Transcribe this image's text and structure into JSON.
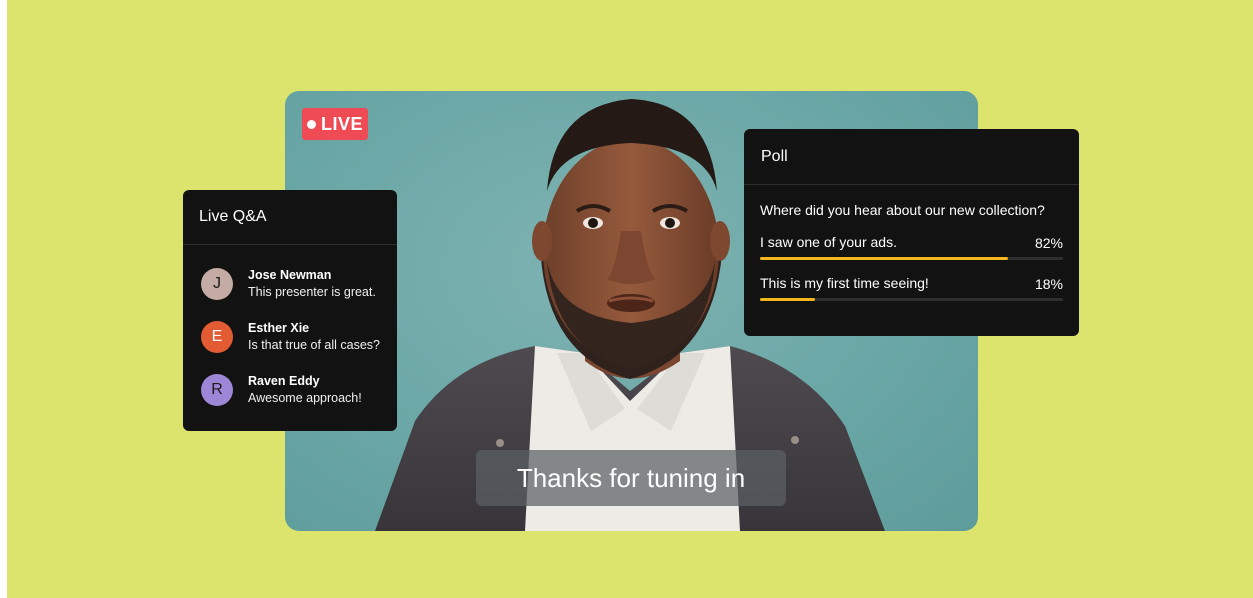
{
  "colors": {
    "background": "#dde46e",
    "live": "#ef4b55",
    "panel": "#121212",
    "poll_bar": "#f3b71b"
  },
  "stream": {
    "live_label": "LIVE",
    "caption": "Thanks for tuning in"
  },
  "qa": {
    "title": "Live Q&A",
    "items": [
      {
        "initial": "J",
        "name": "Jose Newman",
        "message": "This presenter is great.",
        "avatar_color": "#c4aba3"
      },
      {
        "initial": "E",
        "name": "Esther Xie",
        "message": "Is that true of all cases?",
        "avatar_color": "#e25b33"
      },
      {
        "initial": "R",
        "name": "Raven Eddy",
        "message": "Awesome approach!",
        "avatar_color": "#9d86d6"
      }
    ]
  },
  "poll": {
    "title": "Poll",
    "question": "Where did you hear about our new collection?",
    "options": [
      {
        "label": "I saw one of your ads.",
        "percent_label": "82%",
        "percent": 82
      },
      {
        "label": "This is my first time seeing!",
        "percent_label": "18%",
        "percent": 18
      }
    ]
  }
}
